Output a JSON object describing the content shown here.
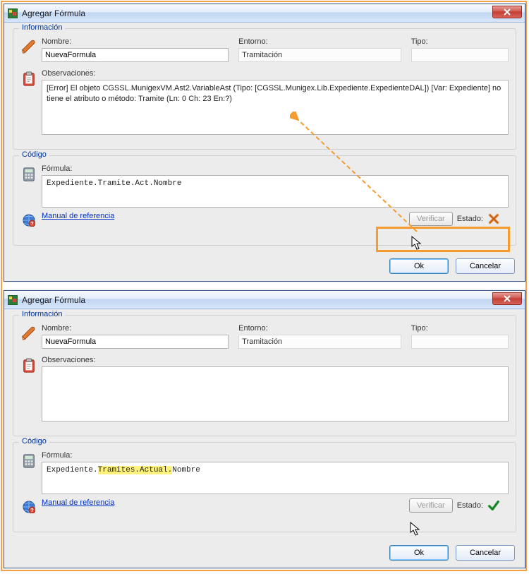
{
  "colors": {
    "accent_orange": "#f59b2f",
    "link_blue": "#0033cc",
    "legend_blue": "#003399"
  },
  "win1": {
    "title": "Agregar Fórmula",
    "info_legend": "Información",
    "codigo_legend": "Código",
    "nombre_label": "Nombre:",
    "nombre_value": "NuevaFormula",
    "entorno_label": "Entorno:",
    "entorno_value": "Tramitación",
    "tipo_label": "Tipo:",
    "tipo_value": "",
    "obs_label": "Observaciones:",
    "obs_value": "[Error] El objeto CGSSL.MunigexVM.Ast2.VariableAst (Tipo: [CGSSL.Munigex.Lib.Expediente.ExpedienteDAL]) [Var: Expediente] no tiene el atributo o método: Tramite (Ln: 0 Ch: 23 En:?)",
    "formula_label": "Fórmula:",
    "formula_value": "Expediente.Tramite.Act.Nombre",
    "manual_link": "Manual de referencia",
    "verificar_label": "Verificar",
    "estado_label": "Estado:",
    "status": "error",
    "ok_label": "Ok",
    "cancel_label": "Cancelar"
  },
  "win2": {
    "title": "Agregar Fórmula",
    "info_legend": "Información",
    "codigo_legend": "Código",
    "nombre_label": "Nombre:",
    "nombre_value": "NuevaFormula",
    "entorno_label": "Entorno:",
    "entorno_value": "Tramitación",
    "tipo_label": "Tipo:",
    "tipo_value": "",
    "obs_label": "Observaciones:",
    "obs_value": "",
    "formula_label": "Fórmula:",
    "formula_prefix": "Expediente.",
    "formula_highlight": "Tramites.Actual.",
    "formula_suffix": "Nombre",
    "manual_link": "Manual de referencia",
    "verificar_label": "Verificar",
    "estado_label": "Estado:",
    "status": "ok",
    "ok_label": "Ok",
    "cancel_label": "Cancelar"
  }
}
